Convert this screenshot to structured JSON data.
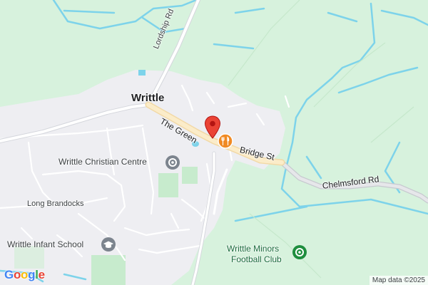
{
  "map": {
    "place_name": "Writtle",
    "roads": {
      "lordship": "Lordship Rd",
      "green": "The Green",
      "bridge": "Bridge St",
      "chelmsford": "Chelmsford Rd",
      "brandocks": "Long Brandocks"
    },
    "pois": {
      "christian_centre": "Writtle Christian Centre",
      "infant_school": "Writtle Infant School",
      "minors_line1": "Writtle Minors",
      "minors_line2": "Football Club"
    },
    "icons": {
      "pin": "location-pin",
      "restaurant": "restaurant-fork-knife",
      "worship": "place-of-worship",
      "school": "school-graduation-cap",
      "sports": "sports-ground"
    },
    "attribution": "Map data ©2025",
    "logo": [
      "G",
      "o",
      "o",
      "g",
      "l",
      "e"
    ],
    "colors": {
      "land_green": "#d7f2dd",
      "urban": "#eeeef2",
      "water": "#7dd3ea",
      "pin": "#ea4335",
      "restaurant": "#f08a24",
      "poi_grey": "#7c848e",
      "poi_green": "#1e8e3e"
    }
  }
}
